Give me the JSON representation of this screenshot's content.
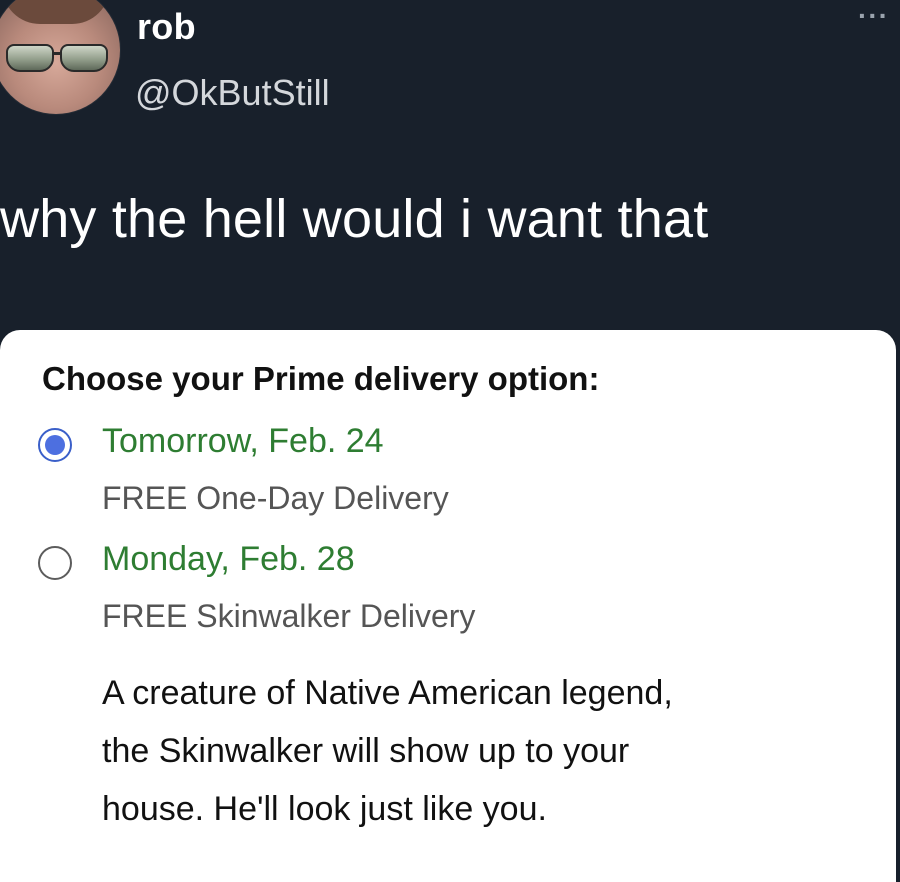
{
  "tweet": {
    "display_name": "rob",
    "handle": "@OkButStill",
    "more_label": "···",
    "text": "why the hell would i want that"
  },
  "card": {
    "title": "Choose your Prime delivery option:",
    "options": [
      {
        "date": "Tomorrow, Feb. 24",
        "description": "FREE One-Day Delivery",
        "selected": true
      },
      {
        "date": "Monday, Feb. 28",
        "description": "FREE Skinwalker Delivery",
        "selected": false,
        "details": [
          "A creature of Native American legend,",
          "the Skinwalker will show up to your",
          "house. He'll look just like you."
        ]
      }
    ],
    "colors": {
      "date_green": "#2e7d32",
      "radio_blue": "#4d6fe0"
    }
  }
}
